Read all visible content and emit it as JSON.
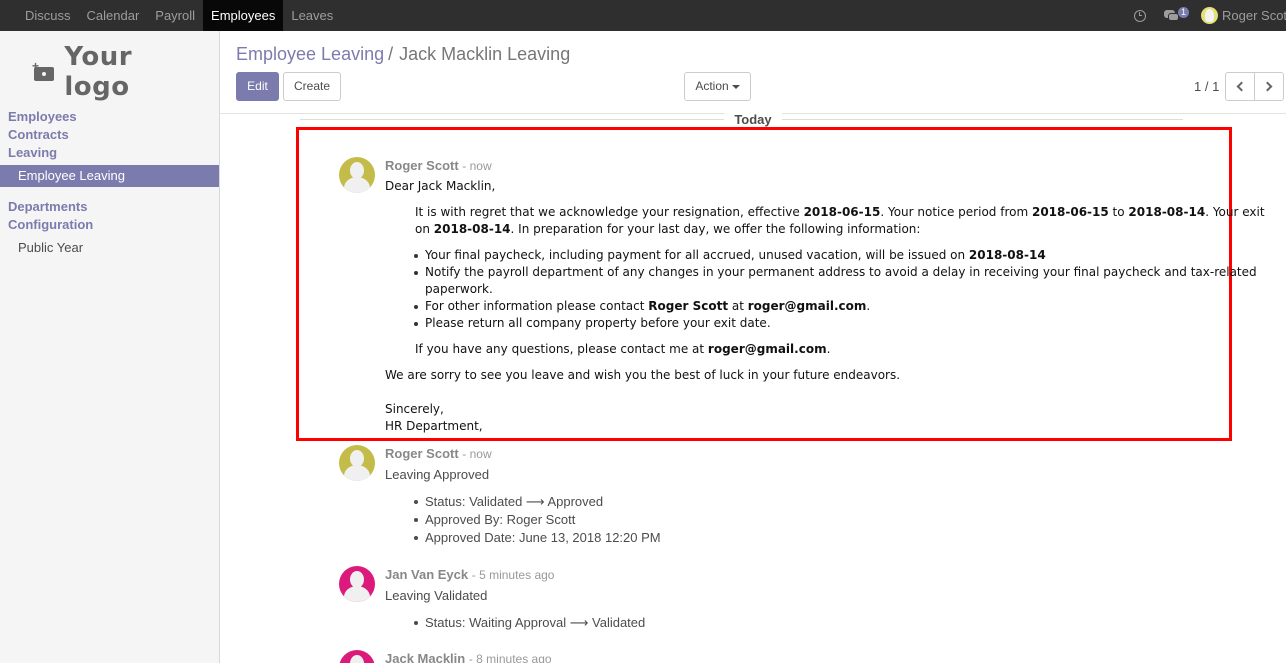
{
  "nav": {
    "items": [
      "Discuss",
      "Calendar",
      "Payroll",
      "Employees",
      "Leaves"
    ],
    "active": "Employees",
    "chat_count": "1",
    "user": "Roger Scott"
  },
  "sidebar": {
    "logo_text": "Your logo",
    "groups": [
      "Employees",
      "Contracts",
      "Leaving",
      "Departments",
      "Configuration"
    ],
    "active_item": "Employee Leaving",
    "sub_item": "Public Year"
  },
  "control": {
    "breadcrumb_parent": "Employee Leaving",
    "breadcrumb_sep": "/",
    "breadcrumb_current": "Jack Macklin Leaving",
    "edit": "Edit",
    "create": "Create",
    "action": "Action",
    "pager": "1 / 1"
  },
  "chatter": {
    "day": "Today",
    "messages": [
      {
        "author": "Roger Scott",
        "time": "- now",
        "greeting": "Dear Jack Macklin,",
        "p1a": "It is with regret that we acknowledge your resignation, effective ",
        "p1_date1": "2018-06-15",
        "p1b": ". Your notice period from ",
        "p1_date2": "2018-06-15",
        "p1c": " to ",
        "p1_date3": "2018-08-14",
        "p1d": ". Your exit",
        "p1e": "on ",
        "p1_date4": "2018-08-14",
        "p1f": ". In preparation for your last day, we offer the following information:",
        "b1a": "Your final paycheck, including payment for all accrued, unused vacation, will be issued on ",
        "b1_date": "2018-08-14",
        "b2a": "Notify the payroll department of any changes in your permanent address to avoid a delay in receiving your final paycheck and tax-related",
        "b2b": "paperwork.",
        "b3a": "For other information please contact ",
        "b3_name": "Roger Scott",
        "b3b": " at ",
        "b3_email": "roger@gmail.com",
        "b3c": ".",
        "b4": "Please return all company property before your exit date.",
        "q1": "If you have any questions, please contact me at ",
        "q_email": "roger@gmail.com",
        "q2": ".",
        "closing": "We are sorry to see you leave and wish you the best of luck in your future endeavors.",
        "sign1": "Sincerely,",
        "sign2": "HR Department,"
      },
      {
        "author": "Roger Scott",
        "time": "- now",
        "subject": "Leaving Approved",
        "items": [
          "Status: Validated ⟶ Approved",
          "Approved By: Roger Scott",
          "Approved Date: June 13, 2018 12:20 PM"
        ]
      },
      {
        "author": "Jan Van Eyck",
        "time": "- 5 minutes ago",
        "subject": "Leaving Validated",
        "items": [
          "Status: Waiting Approval ⟶ Validated"
        ]
      },
      {
        "author": "Jack Macklin",
        "time": "- 8 minutes ago"
      }
    ]
  },
  "colors": {
    "brand": "#7c7bad",
    "navbar": "#2f2f2f",
    "highlight": "#ff0000"
  }
}
